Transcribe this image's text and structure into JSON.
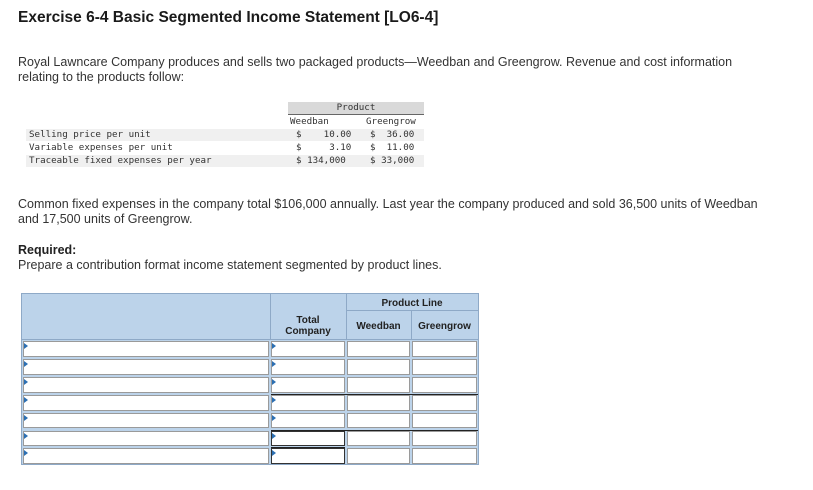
{
  "title": "Exercise 6-4 Basic Segmented Income Statement [LO6-4]",
  "intro_line1": "Royal Lawncare Company produces and sells two packaged products—Weedban and Greengrow. Revenue and cost information",
  "intro_line2": "relating to the products follow:",
  "data_table": {
    "group_header": "Product",
    "columns": [
      "Weedban",
      "Greengrow"
    ],
    "rows": [
      {
        "label": "Selling price per unit",
        "weedban": "$    10.00",
        "greengrow": "$  36.00"
      },
      {
        "label": "Variable expenses per unit",
        "weedban": "$     3.10",
        "greengrow": "$  11.00"
      },
      {
        "label": "Traceable fixed expenses per year",
        "weedban": "$ 134,000",
        "greengrow": "$ 33,000"
      }
    ]
  },
  "para2_line1": "Common fixed expenses in the company total $106,000 annually. Last year the company produced and sold 36,500 units of Weedban",
  "para2_line2": "and 17,500 units of Greengrow.",
  "required_heading": "Required:",
  "required_text": "Prepare a contribution format income statement segmented by product lines.",
  "answer_grid": {
    "product_line_header": "Product Line",
    "total_header_line1": "Total",
    "total_header_line2": "Company",
    "weedban_header": "Weedban",
    "greengrow_header": "Greengrow",
    "row_count": 7,
    "accent_color": "#bcd3ea"
  }
}
